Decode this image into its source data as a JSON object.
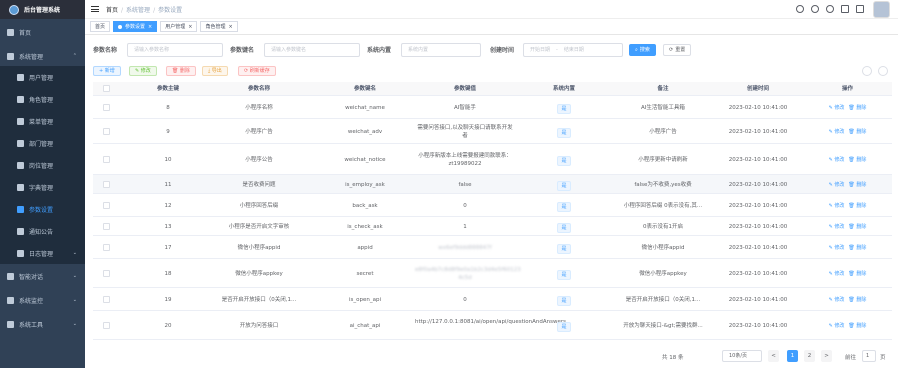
{
  "app": {
    "title": "后台管理系统"
  },
  "sidebar": {
    "items": [
      {
        "label": "首页",
        "icon": "dashboard-icon"
      },
      {
        "label": "系统管理",
        "icon": "system-icon",
        "arrow": "⌃"
      },
      {
        "label": "用户管理",
        "icon": "user-icon"
      },
      {
        "label": "角色管理",
        "icon": "peoples-icon"
      },
      {
        "label": "菜单管理",
        "icon": "tree-table-icon"
      },
      {
        "label": "部门管理",
        "icon": "tree-icon"
      },
      {
        "label": "岗位管理",
        "icon": "post-icon"
      },
      {
        "label": "字典管理",
        "icon": "dict-icon"
      },
      {
        "label": "参数设置",
        "icon": "edit-icon"
      },
      {
        "label": "通知公告",
        "icon": "message-icon"
      },
      {
        "label": "日志管理",
        "icon": "log-icon",
        "arrow": "⌄"
      },
      {
        "label": "智能对话",
        "icon": "chat-icon",
        "arrow": "⌄"
      },
      {
        "label": "系统监控",
        "icon": "monitor-icon",
        "arrow": "⌄"
      },
      {
        "label": "系统工具",
        "icon": "tool-icon",
        "arrow": "⌄"
      }
    ]
  },
  "breadcrumb": {
    "items": [
      "首页",
      "系统管理",
      "参数设置"
    ],
    "sep": "/"
  },
  "tags": [
    {
      "label": "首页"
    },
    {
      "label": "参数设置",
      "close": "×"
    },
    {
      "label": "用户管理",
      "close": "×"
    },
    {
      "label": "角色管理",
      "close": "×"
    }
  ],
  "search": {
    "config_name_label": "参数名称",
    "config_name_placeholder": "请输入参数名称",
    "config_key_label": "参数键名",
    "config_key_placeholder": "请输入参数键名",
    "config_type_label": "系统内置",
    "config_type_placeholder": "系统内置",
    "create_time_label": "创建时间",
    "start_placeholder": "开始日期",
    "range_sep": "-",
    "end_placeholder": "结束日期",
    "search_button": "搜索",
    "reset_button": "重置"
  },
  "toolbar": {
    "add": "+ 新增",
    "edit": "✎ 修改",
    "delete": "🗑 删除",
    "export": "⤓ 导出",
    "refresh": "⟳ 刷新缓存"
  },
  "table": {
    "columns": [
      "参数主键",
      "参数名称",
      "参数键名",
      "参数键值",
      "系统内置",
      "备注",
      "创建时间",
      "操作"
    ],
    "rows": [
      {
        "id": "8",
        "name": "小程序名称",
        "key": "weichat_name",
        "value": "AI智能手",
        "builtin": "是",
        "remark": "AI生活智能工具箱",
        "time": "2023-02-10 10:41:00"
      },
      {
        "id": "9",
        "name": "小程序广告",
        "key": "weichat_adv",
        "value": "需要问答接口,以及聊天接口请联系开发者",
        "builtin": "是",
        "remark": "小程序广告",
        "time": "2023-02-10 10:41:00"
      },
      {
        "id": "10",
        "name": "小程序公告",
        "key": "weichat_notice",
        "value": "小程序新版本上线需要报建同款联系：zt19989022",
        "builtin": "是",
        "remark": "小程序更新中请刷新",
        "time": "2023-02-10 10:41:00"
      },
      {
        "id": "11",
        "name": "是否收费问题",
        "key": "is_employ_ask",
        "value": "false",
        "builtin": "是",
        "remark": "false为不收费,yes收费",
        "time": "2023-02-10 10:41:00"
      },
      {
        "id": "12",
        "name": "小程序回答后缀",
        "key": "back_ask",
        "value": "0",
        "builtin": "是",
        "remark": "小程序回答后缀 0表示没有,其...",
        "time": "2023-02-10 10:41:00"
      },
      {
        "id": "13",
        "name": "小程序是否开启文字审核",
        "key": "is_check_ask",
        "value": "1",
        "builtin": "是",
        "remark": "0表示没有1开启",
        "time": "2023-02-10 10:41:00"
      },
      {
        "id": "17",
        "name": "微信小程序appid",
        "key": "appid",
        "value": "wx6ef9ddd888847f",
        "builtin": "是",
        "remark": "微信小程序appid",
        "time": "2023-02-10 10:41:00"
      },
      {
        "id": "18",
        "name": "微信小程序appkey",
        "key": "secret",
        "value": "e8f0a4b7c8d8f9e0a1b2c3d4e5f60123 4c5d",
        "builtin": "是",
        "remark": "微信小程序appkey",
        "time": "2023-02-10 10:41:00"
      },
      {
        "id": "19",
        "name": "是否开启开放接口（0关闭,1...",
        "key": "is_open_api",
        "value": "0",
        "builtin": "是",
        "remark": "是否开启开放接口（0关闭,1...",
        "time": "2023-02-10 10:41:00"
      },
      {
        "id": "20",
        "name": "开放为问答接口",
        "key": "ai_chat_api",
        "value": "http://127.0.0.1:8081/ai/open/api/questionAndAnswers",
        "builtin": "是",
        "remark": "开放为聊天接口-&gt;需要找群...",
        "time": "2023-02-10 10:41:00"
      }
    ],
    "edit_op": "✎ 修改",
    "delete_op": "🗑 删除"
  },
  "pager": {
    "total": "共 18 条",
    "size": "10条/页",
    "prev": "<",
    "pages": [
      "1",
      "2"
    ],
    "next": ">",
    "goto": "前往",
    "page_val": "1",
    "unit": "页"
  },
  "colors": {
    "sidebar_bg": "#304156",
    "primary": "#409eff",
    "active_text": "#409eff"
  }
}
